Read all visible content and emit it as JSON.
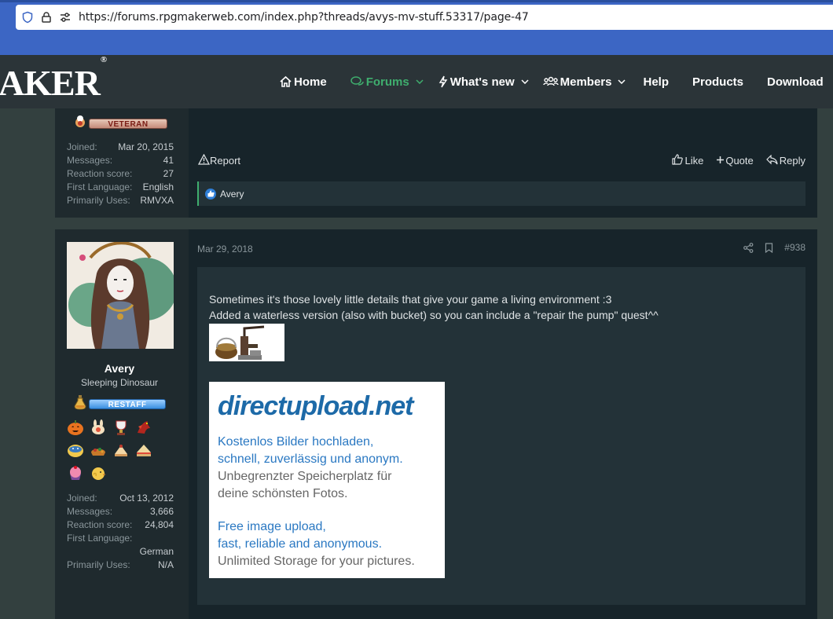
{
  "browser": {
    "url": "https://forums.rpgmakerweb.com/index.php?threads/avys-mv-stuff.53317/page-47"
  },
  "site": {
    "logo_text": "AKER",
    "logo_mark": "®",
    "nav": [
      {
        "label": "Home",
        "icon": "home-icon",
        "active": false,
        "dropdown": false
      },
      {
        "label": "Forums",
        "icon": "chat-icon",
        "active": true,
        "dropdown": true
      },
      {
        "label": "What's new",
        "icon": "bolt-icon",
        "active": false,
        "dropdown": true
      },
      {
        "label": "Members",
        "icon": "users-icon",
        "active": false,
        "dropdown": true
      },
      {
        "label": "Help",
        "icon": "",
        "active": false,
        "dropdown": false
      },
      {
        "label": "Products",
        "icon": "",
        "active": false,
        "dropdown": false
      },
      {
        "label": "Download",
        "icon": "",
        "active": false,
        "dropdown": false
      }
    ],
    "colors": {
      "accent": "#3fae6e",
      "link_blue": "#2f7fd8"
    }
  },
  "prev_post": {
    "rank": "VETERAN",
    "stats": [
      {
        "label": "Joined:",
        "value": "Mar 20, 2015"
      },
      {
        "label": "Messages:",
        "value": "41"
      },
      {
        "label": "Reaction score:",
        "value": "27"
      },
      {
        "label": "First Language:",
        "value": "English"
      },
      {
        "label": "Primarily Uses:",
        "value": "RMVXA"
      }
    ],
    "actions": {
      "report": "Report",
      "like": "Like",
      "quote": "Quote",
      "reply": "Reply"
    },
    "reaction_user": "Avery"
  },
  "post": {
    "username": "Avery",
    "user_title": "Sleeping Dinosaur",
    "rank": "RESTAFF",
    "trophies": [
      "pumpkin-icon",
      "bunny-icon",
      "trophy-cup-icon",
      "dragon-icon",
      "snake-icon",
      "pie-icon",
      "cake-slice-icon",
      "sandwich-icon",
      "cupcake-icon",
      "chick-icon"
    ],
    "stats": [
      {
        "label": "Joined:",
        "value": "Oct 13, 2012"
      },
      {
        "label": "Messages:",
        "value": "3,666"
      },
      {
        "label": "Reaction score:",
        "value": "24,804"
      },
      {
        "label": "First Language:",
        "value": ""
      },
      {
        "label": "",
        "value": "German"
      },
      {
        "label": "Primarily Uses:",
        "value": "N/A"
      }
    ],
    "date": "Mar 29, 2018",
    "post_number": "#938",
    "body_line1": "Sometimes it's those lovely little details that give your game a living environment :3",
    "body_line2": "Added a waterless version (also with bucket) so you can include a \"repair the pump\" quest^^",
    "directupload": {
      "logo_a": "directupload",
      "logo_b": ".net",
      "de_line1": "Kostenlos Bilder hochladen,",
      "de_line2": "schnell, zuverlässig und anonym.",
      "de_line3": "Unbegrenzter Speicherplatz für",
      "de_line4": "deine schönsten Fotos.",
      "en_line1": "Free image upload,",
      "en_line2": "fast, reliable and anonymous.",
      "en_line3": "Unlimited Storage for your pictures."
    }
  }
}
